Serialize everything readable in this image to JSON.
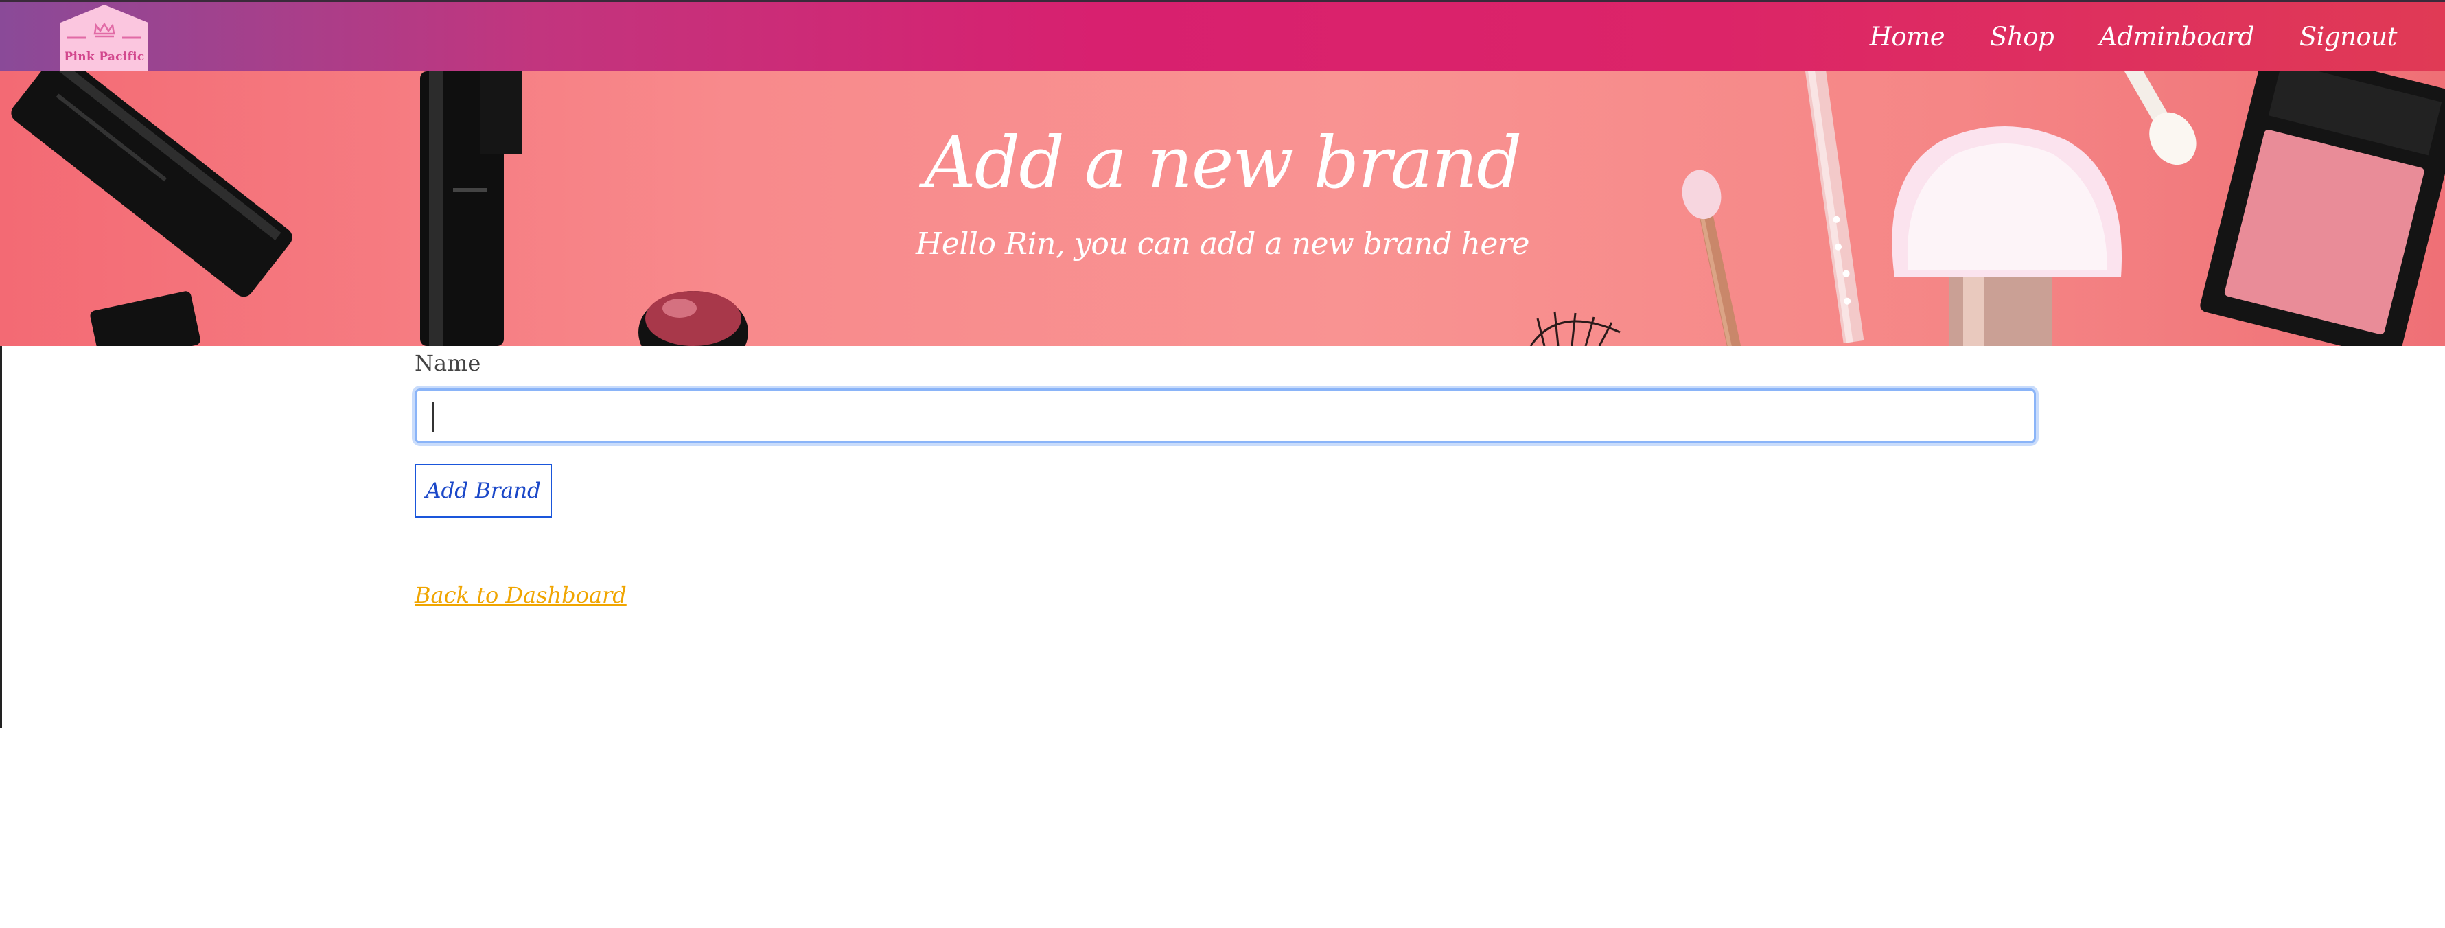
{
  "brand": {
    "name": "Pink Pacific",
    "logo_icon": "crown-icon"
  },
  "nav": {
    "items": [
      {
        "label": "Home"
      },
      {
        "label": "Shop"
      },
      {
        "label": "Adminboard"
      },
      {
        "label": "Signout"
      }
    ]
  },
  "hero": {
    "title": "Add a new brand",
    "subtitle": "Hello Rin, you can add a new brand here",
    "background_image": "makeup-products-banner"
  },
  "form": {
    "name_label": "Name",
    "name_value": "",
    "name_placeholder": "",
    "submit_label": "Add Brand"
  },
  "footer_link": {
    "label": "Back to Dashboard"
  },
  "colors": {
    "nav_gradient_start": "#8a4a98",
    "nav_gradient_end": "#e03a55",
    "hero_background": "#f88a8c",
    "button_border": "#1a56db",
    "link_color": "#f0a500",
    "input_focus": "#8ab4f8"
  }
}
